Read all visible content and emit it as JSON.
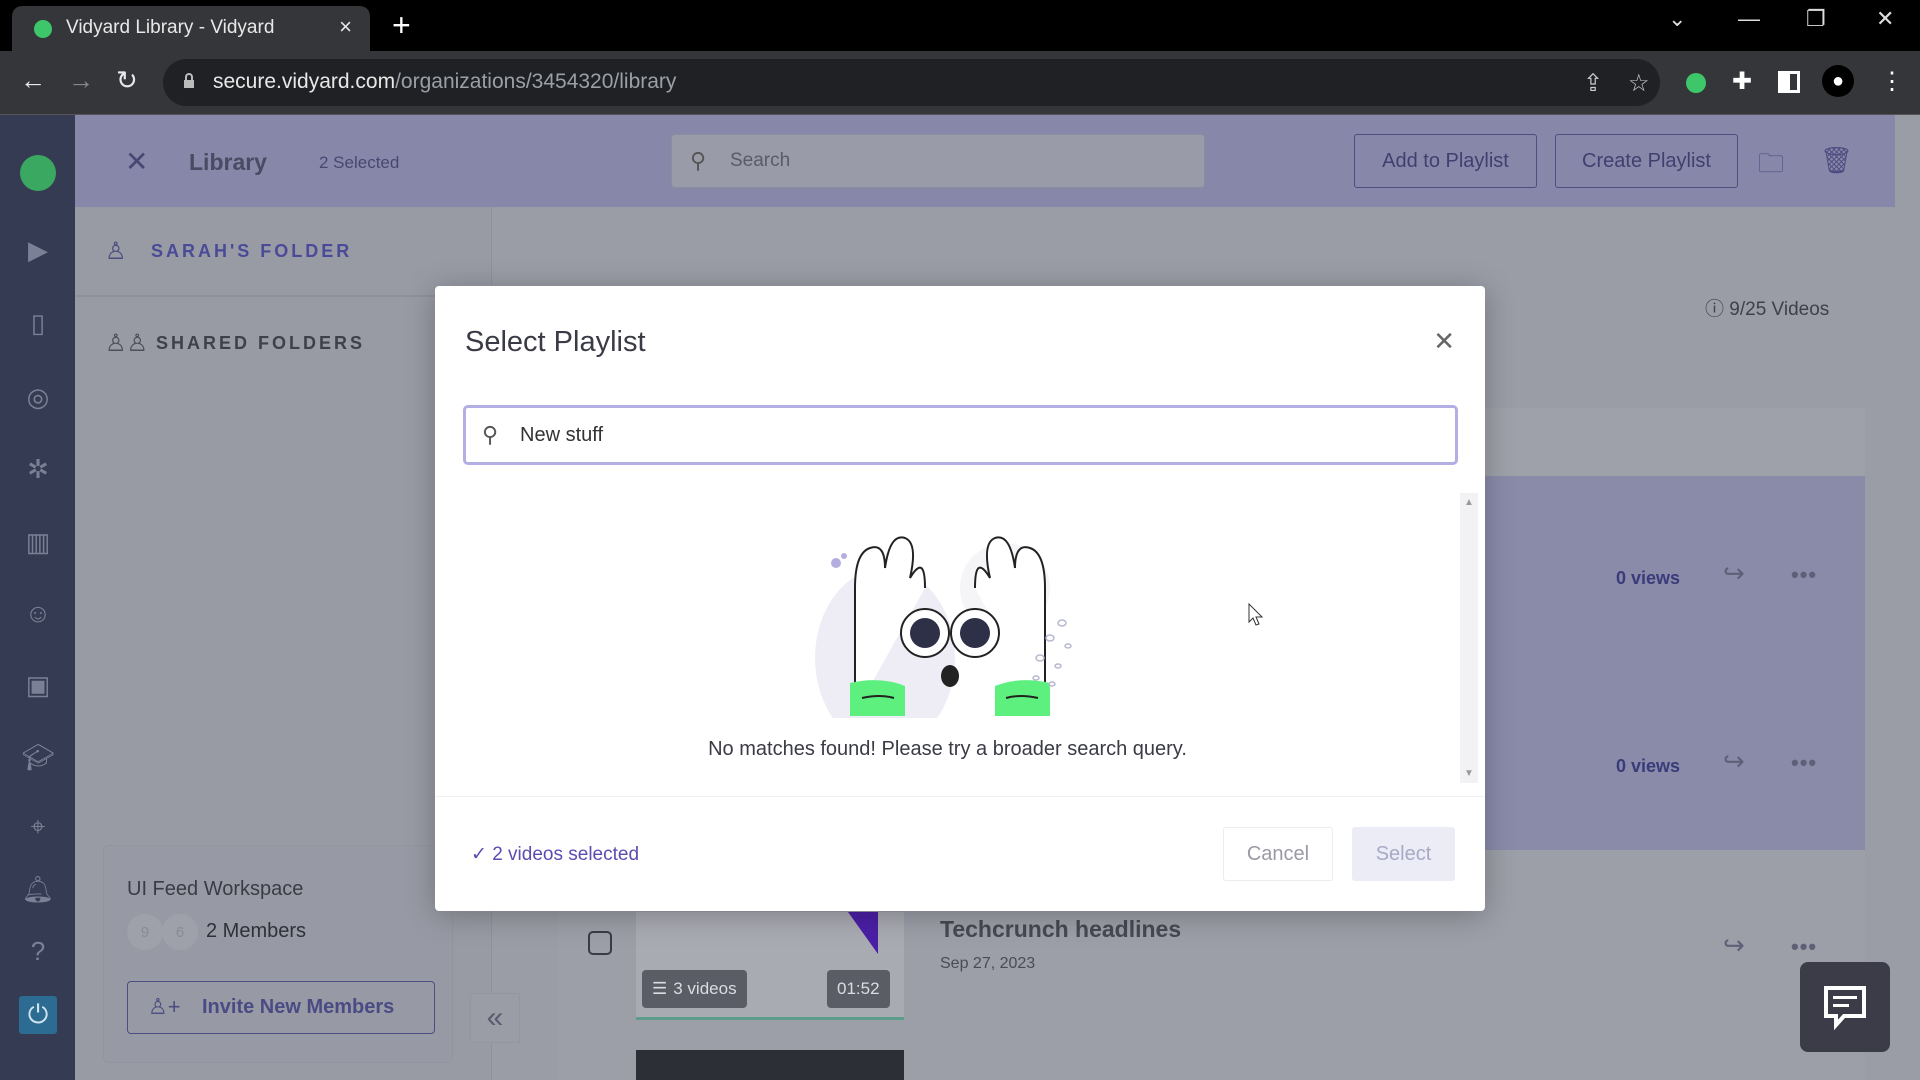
{
  "browser": {
    "tab_title": "Vidyard Library - Vidyard",
    "tab_close": "×",
    "new_tab": "+",
    "url_host": "secure.vidyard.com",
    "url_path": "/organizations/3454320/library",
    "window_controls": {
      "dropdown": "⌄",
      "minimize": "—",
      "restore": "❐",
      "close": "✕"
    }
  },
  "header": {
    "close_icon": "✕",
    "title": "Library",
    "selected_count": "2 Selected",
    "search_placeholder": "Search",
    "add_to_playlist": "Add to Playlist",
    "create_playlist": "Create Playlist"
  },
  "sidepanel": {
    "items": [
      {
        "label": "SARAH'S FOLDER",
        "icon": "user-icon"
      },
      {
        "label": "SHARED FOLDERS",
        "icon": "users-icon"
      }
    ],
    "workspace": {
      "name": "UI Feed Workspace",
      "avatars": [
        "9",
        "6"
      ],
      "members": "2 Members",
      "invite_label": "Invite New Members"
    },
    "collapse_icon": "«"
  },
  "library": {
    "video_count": "9/25 Videos",
    "rows": [
      {
        "views": "0 views",
        "selected": true
      },
      {
        "views": "0 views",
        "selected": true
      },
      {
        "title": "Techcrunch headlines",
        "date": "Sep 27, 2023",
        "videos_badge": "3 videos",
        "duration": "01:52",
        "selected": false
      }
    ]
  },
  "modal": {
    "title": "Select Playlist",
    "close_icon": "✕",
    "search_value": "New stuff",
    "empty_message": "No matches found! Please try a broader search query.",
    "selected_summary": "2 videos selected",
    "cancel_label": "Cancel",
    "select_label": "Select"
  },
  "colors": {
    "accent": "#5b4db0",
    "search_focus_border": "#b3aee4",
    "nav_bg": "#343b52",
    "brand_green": "#3ec76a"
  }
}
